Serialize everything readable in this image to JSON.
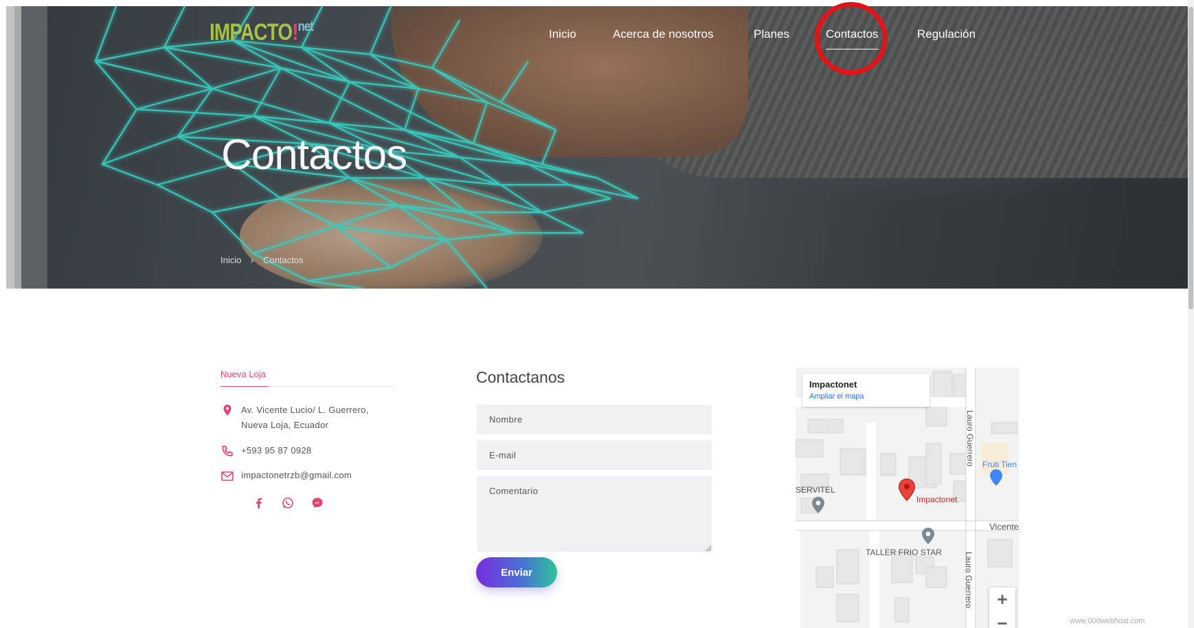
{
  "brand": {
    "logo_main": "IMPACTO",
    "logo_bang": "!",
    "logo_suffix": "net"
  },
  "nav": {
    "items": [
      "Inicio",
      "Acerca de nosotros",
      "Planes",
      "Contactos",
      "Regulación"
    ],
    "active": "Contactos"
  },
  "hero": {
    "title": "Contactos",
    "breadcrumb": [
      "Inicio",
      "›",
      "Contactos"
    ]
  },
  "location": {
    "title": "Nueva Loja",
    "address_line1": "Av. Vicente Lucio/ L. Guerrero,",
    "address_line2": "Nueva Loja, Ecuador",
    "phone": "+593 95 87 0928",
    "email": "impactonetrzb@gmail.com",
    "social": [
      "facebook-icon",
      "whatsapp-icon",
      "messenger-icon"
    ]
  },
  "form": {
    "title": "Contactanos",
    "name_placeholder": "Nombre",
    "email_placeholder": "E-mail",
    "comment_placeholder": "Comentario",
    "submit": "Enviar"
  },
  "map": {
    "place_name": "Impactonet",
    "enlarge_link": "Ampliar el mapa",
    "street_1": "Lauro Guerrero",
    "street_2": "Lauro Guerrero",
    "street_3": "Vicente",
    "poi_1": "SERVITEL",
    "poi_2": "TALLER FRIO STAR",
    "poi_3": "Fruti Tien",
    "marker_label": "Impactonet",
    "zoom_in": "+",
    "zoom_out": "−"
  },
  "footer_badge": "www.000webhost.com",
  "colors": {
    "accent": "#e4436e",
    "button_start": "#7b2bdc",
    "button_end": "#2fc39a",
    "active_mark": "#e2141a"
  }
}
